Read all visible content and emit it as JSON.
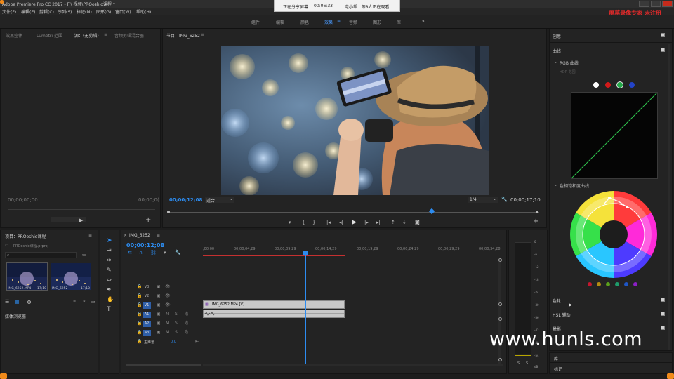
{
  "app": {
    "title": "Adobe Premiere Pro CC 2017 - F:\\ 视频\\PROoshio课程 *",
    "menu": [
      "文件(F)",
      "编辑(E)",
      "剪辑(C)",
      "序列(S)",
      "标记(M)",
      "图形(G)",
      "窗口(W)",
      "帮助(H)"
    ],
    "top_watermark": "屏幕录像专家  未注册"
  },
  "share_bar": {
    "status": "正在分享屏幕",
    "time": "00:06:33",
    "viewers": "屯小帮...等8人正在观看"
  },
  "workspaces": {
    "items": [
      "组件",
      "编辑",
      "颜色",
      "效果",
      "音频",
      "图形",
      "库"
    ],
    "active_index": 3,
    "more": "»"
  },
  "source_panel": {
    "tabs": [
      "效果控件",
      "Lumetri 范围",
      "源：(无剪辑)",
      "音频剪辑混合器"
    ],
    "active_tab": 2,
    "menu_icon": "≡",
    "timecode_left": "00;00;00;00",
    "timecode_right": "00;00;0("
  },
  "program_panel": {
    "tab": "节目：IMG_6252",
    "menu_icon": "≡",
    "timecode": "00;00;12;08",
    "fit": "适合",
    "quality": "1/4",
    "duration": "00;00;17;10",
    "playhead_fraction": 0.71
  },
  "project_panel": {
    "title": "项目：PROoshio课程",
    "menu_icon": "≡",
    "file": "PROoshio课程.prproj",
    "items_count": "",
    "thumbs": [
      {
        "name": "IMG_6252.MP4",
        "duration": "17;10"
      },
      {
        "name": "IMG_6252",
        "duration": "17;10"
      }
    ],
    "browser_label": "媒体浏览器"
  },
  "timeline": {
    "tab": "IMG_6252",
    "menu_icon": "≡",
    "timecode": "00;00;12;08",
    "ruler": [
      ";00;00",
      "00;00;04;29",
      "00;00;09;29",
      "00;00;14;29",
      "00;00;19;29",
      "00;00;24;29",
      "00;00;29;29",
      "00;00;34;28"
    ],
    "tracks": [
      {
        "name": "V3",
        "active": false
      },
      {
        "name": "V2",
        "active": false
      },
      {
        "name": "V1",
        "active": true
      },
      {
        "name": "A1",
        "active": true
      },
      {
        "name": "A2",
        "active": true
      },
      {
        "name": "A3",
        "active": true
      }
    ],
    "master_label": "主声道",
    "master_value": "0.0",
    "clip_label": "IMG_6252.MP4 [V]",
    "playhead_fraction": 0.34
  },
  "meters": {
    "scale": [
      "0",
      "-6",
      "-12",
      "-18",
      "-24",
      "-30",
      "-36",
      "-42",
      "-48",
      "-54"
    ],
    "unit": "dB",
    "solo": [
      "S",
      "S"
    ]
  },
  "lumetri": {
    "sections": {
      "creative": "创意",
      "curves": "曲线",
      "rgb_curves": "RGB 曲线",
      "hdr": "HDR 范围",
      "hue_sat": "色相饱和度曲线",
      "wheels": "色轮",
      "hsl": "HSL 辅助",
      "vignette": "晕影"
    },
    "channel_colors": [
      "#ffffff",
      "#d11a1a",
      "#25a84a",
      "#2343c7"
    ],
    "hue_dots": [
      "#c4162e",
      "#b38b12",
      "#5ba01c",
      "#1e9c6b",
      "#1f56c6",
      "#8c1fc6"
    ]
  },
  "library_panel": {
    "items": [
      "库",
      "标记"
    ]
  },
  "site_watermark": "www.hunls.com"
}
